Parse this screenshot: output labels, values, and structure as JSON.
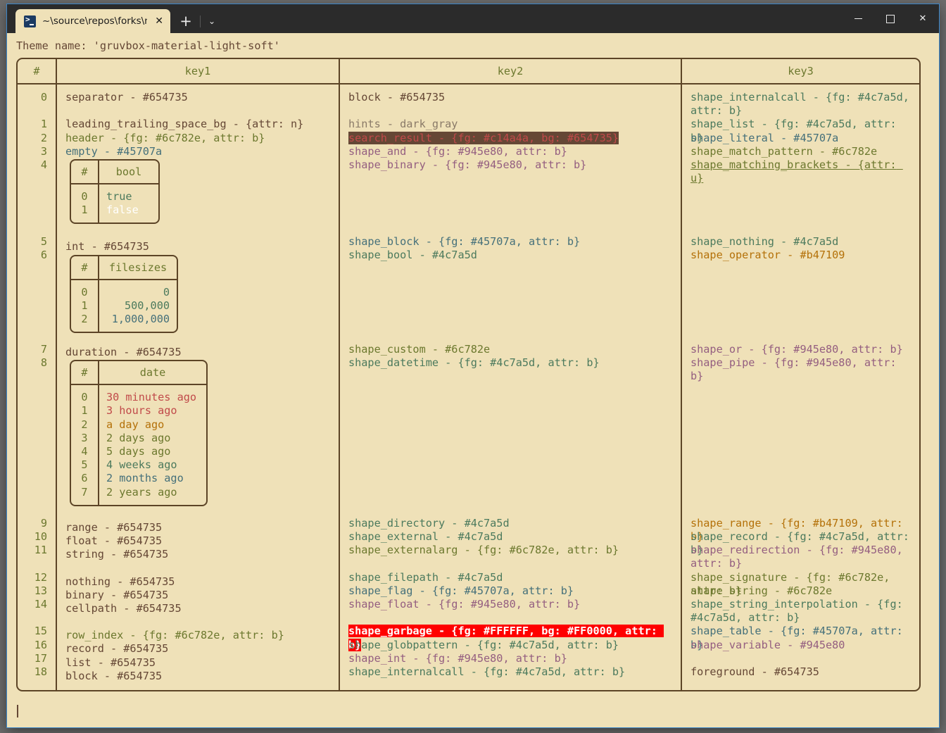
{
  "window": {
    "tab_title": "~\\source\\repos\\forks\\nu_scrip",
    "tab_icon": "powershell-icon",
    "close_label": "✕",
    "new_tab_label": "+",
    "dropdown_label": "⌄",
    "minimize_label": "",
    "maximize_label": "",
    "close_window_label": "✕"
  },
  "terminal": {
    "theme_line": "Theme name: 'gruvbox-material-light-soft'",
    "prompt_caret": ""
  },
  "table": {
    "headers": {
      "index": "#",
      "key1": "key1",
      "key2": "key2",
      "key3": "key3"
    },
    "indices": {
      "g1": [
        "0",
        "",
        "1",
        "2",
        "3",
        "4"
      ],
      "g2": [
        "5",
        "6"
      ],
      "g3": [
        "7",
        "8"
      ],
      "g4": [
        "9",
        "10",
        "11",
        "",
        "12",
        "13",
        "14",
        "",
        "15",
        "16",
        "17",
        "18"
      ]
    },
    "key1": {
      "row0": "separator - #654735",
      "row1": "leading_trailing_space_bg - {attr: n}",
      "row2": "header - {fg: #6c782e, attr: b}",
      "row3": "empty - #45707a",
      "row5": "int - #654735",
      "row7": "duration - #654735",
      "row9": "range - #654735",
      "row10": "float - #654735",
      "row11": "string - #654735",
      "row12": "nothing - #654735",
      "row13": "binary - #654735",
      "row14": "cellpath - #654735",
      "row15": "row_index - {fg: #6c782e, attr: b}",
      "row16": "record - #654735",
      "row17": "list - #654735",
      "row18": "block - #654735"
    },
    "key2": {
      "row0": "block - #654735",
      "row1": "hints - dark_gray",
      "row2": "search_result - {fg: #c14a4a, bg: #654735}",
      "row3": "shape_and - {fg: #945e80, attr: b}",
      "row4": "shape_binary - {fg: #945e80, attr: b}",
      "row5": "shape_block - {fg: #45707a, attr: b}",
      "row6": "shape_bool - #4c7a5d",
      "row7": "shape_custom - #6c782e",
      "row8": "shape_datetime - {fg: #4c7a5d, attr: b}",
      "row9": "shape_directory - #4c7a5d",
      "row10": "shape_external - #4c7a5d",
      "row11": "shape_externalarg - {fg: #6c782e, attr: b}",
      "row12": "shape_filepath - #4c7a5d",
      "row13": "shape_flag - {fg: #45707a, attr: b}",
      "row14": "shape_float - {fg: #945e80, attr: b}",
      "row15": "shape_garbage - {fg: #FFFFFF, bg: #FF0000, attr: b}",
      "row16": "shape_globpattern - {fg: #4c7a5d, attr: b}",
      "row17": "shape_int - {fg: #945e80, attr: b}",
      "row18": "shape_internalcall - {fg: #4c7a5d, attr: b}"
    },
    "key3": {
      "row0": "shape_internalcall - {fg: #4c7a5d, attr: b}",
      "row1": "shape_list - {fg: #4c7a5d, attr: b}",
      "row2": "shape_literal - #45707a",
      "row3": "shape_match_pattern - #6c782e",
      "row4": "shape_matching_brackets - {attr: u}",
      "row5": "shape_nothing - #4c7a5d",
      "row6": "shape_operator - #b47109",
      "row7": "shape_or - {fg: #945e80, attr: b}",
      "row8": "shape_pipe - {fg: #945e80, attr: b}",
      "row9": "shape_range - {fg: #b47109, attr: b}",
      "row10": "shape_record - {fg: #4c7a5d, attr: b}",
      "row11": "shape_redirection - {fg: #945e80, attr: b}",
      "row12": "shape_signature - {fg: #6c782e, attr: b}",
      "row13": "shape_string - #6c782e",
      "row14": "shape_string_interpolation - {fg: #4c7a5d, attr: b}",
      "row15": "shape_table - {fg: #45707a, attr: b}",
      "row16": "shape_variable - #945e80",
      "row17": "foreground - #654735"
    }
  },
  "bool_table": {
    "headers": {
      "index": "#",
      "value": "bool"
    },
    "rows": [
      {
        "index": "0",
        "value": "true"
      },
      {
        "index": "1",
        "value": "false"
      }
    ]
  },
  "filesizes_table": {
    "headers": {
      "index": "#",
      "value": "filesizes"
    },
    "rows": [
      {
        "index": "0",
        "value": "0"
      },
      {
        "index": "1",
        "value": "500,000"
      },
      {
        "index": "2",
        "value": "1,000,000"
      }
    ]
  },
  "date_table": {
    "headers": {
      "index": "#",
      "value": "date"
    },
    "rows": [
      {
        "index": "0",
        "value": "30 minutes ago"
      },
      {
        "index": "1",
        "value": "3 hours ago"
      },
      {
        "index": "2",
        "value": "a day ago"
      },
      {
        "index": "3",
        "value": "2 days ago"
      },
      {
        "index": "4",
        "value": "5 days ago"
      },
      {
        "index": "5",
        "value": "4 weeks ago"
      },
      {
        "index": "6",
        "value": "2 months ago"
      },
      {
        "index": "7",
        "value": "2 years ago"
      }
    ]
  },
  "colors": {
    "background": "#efe1b8",
    "foreground": "#654735",
    "border": "#5c4426",
    "green": "#6c782e",
    "blue": "#45707a",
    "aqua": "#4c7a5d",
    "purple": "#945e80",
    "orange": "#b47109",
    "red": "#c14a4a",
    "titlebar": "#2b2b2b",
    "window_border": "#3b86c9",
    "garbage_bg": "#ff0000"
  }
}
